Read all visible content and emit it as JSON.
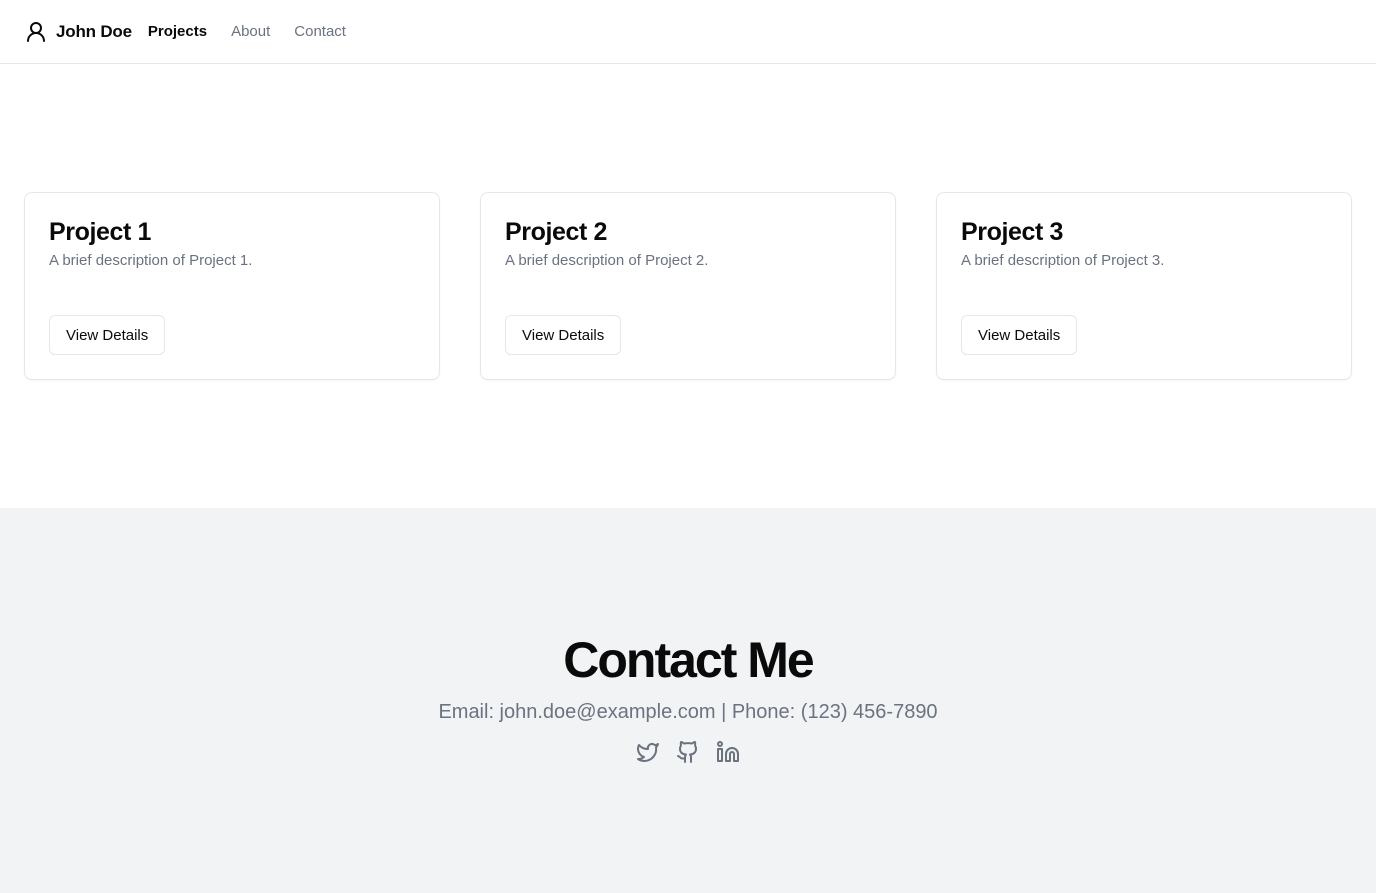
{
  "header": {
    "brand_name": "John Doe",
    "brand_icon": "user-icon",
    "nav": [
      {
        "label": "Projects",
        "active": true
      },
      {
        "label": "About",
        "active": false
      },
      {
        "label": "Contact",
        "active": false
      }
    ]
  },
  "projects": [
    {
      "title": "Project 1",
      "description": "A brief description of Project 1.",
      "button_label": "View Details"
    },
    {
      "title": "Project 2",
      "description": "A brief description of Project 2.",
      "button_label": "View Details"
    },
    {
      "title": "Project 3",
      "description": "A brief description of Project 3.",
      "button_label": "View Details"
    }
  ],
  "contact": {
    "title": "Contact Me",
    "info": "Email: john.doe@example.com | Phone: (123) 456-7890",
    "socials": [
      {
        "icon": "twitter-icon"
      },
      {
        "icon": "github-icon"
      },
      {
        "icon": "linkedin-icon"
      }
    ]
  },
  "colors": {
    "text": "#0a0a0a",
    "muted": "#6b7280",
    "border": "#e5e7eb",
    "contact_bg": "#f2f3f5"
  }
}
